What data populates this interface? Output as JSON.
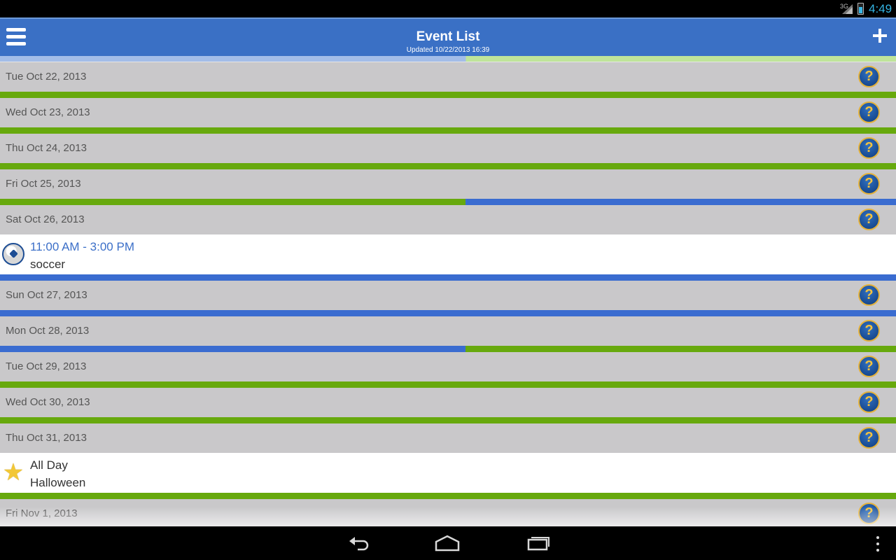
{
  "status_bar": {
    "network": "3G",
    "time": "4:49",
    "battery_level": 0.6
  },
  "app_bar": {
    "title": "Event List",
    "subtitle": "Updated 10/22/2013 16:39",
    "menu_icon": "hamburger-icon",
    "add_icon": "plus-icon"
  },
  "days": [
    {
      "date": "Tue Oct 22, 2013",
      "help_icon": "?",
      "bar": "green"
    },
    {
      "date": "Wed Oct 23, 2013",
      "help_icon": "?",
      "bar": "green"
    },
    {
      "date": "Thu Oct 24, 2013",
      "help_icon": "?",
      "bar": "green"
    },
    {
      "date": "Fri Oct 25, 2013",
      "help_icon": "?",
      "bar": "green-blue"
    },
    {
      "date": "Sat Oct 26, 2013",
      "help_icon": "?",
      "event": {
        "time": "11:00 AM - 3:00 PM",
        "name": "soccer",
        "icon": "soccer-ball-icon",
        "time_color": "#3c6fc8"
      },
      "bar": "blue"
    },
    {
      "date": "Sun Oct 27, 2013",
      "help_icon": "?",
      "bar": "blue"
    },
    {
      "date": "Mon Oct 28, 2013",
      "help_icon": "?",
      "bar": "blue-green"
    },
    {
      "date": "Tue Oct 29, 2013",
      "help_icon": "?",
      "bar": "green"
    },
    {
      "date": "Wed Oct 30, 2013",
      "help_icon": "?",
      "bar": "green"
    },
    {
      "date": "Thu Oct 31, 2013",
      "help_icon": "?",
      "event": {
        "time": "All Day",
        "name": "Halloween",
        "icon": "star-icon",
        "time_color": "#333333"
      },
      "bar": "green"
    },
    {
      "date": "Fri Nov 1, 2013",
      "help_icon": "?"
    }
  ],
  "colors": {
    "green": "#67a90d",
    "blue": "#3a6cd0",
    "header": "#3a70c5",
    "day_bg": "#c9c8ca"
  },
  "nav_bar": {
    "back_icon": "back-icon",
    "home_icon": "home-icon",
    "recent_icon": "recent-apps-icon",
    "menu_icon": "overflow-menu-icon"
  }
}
